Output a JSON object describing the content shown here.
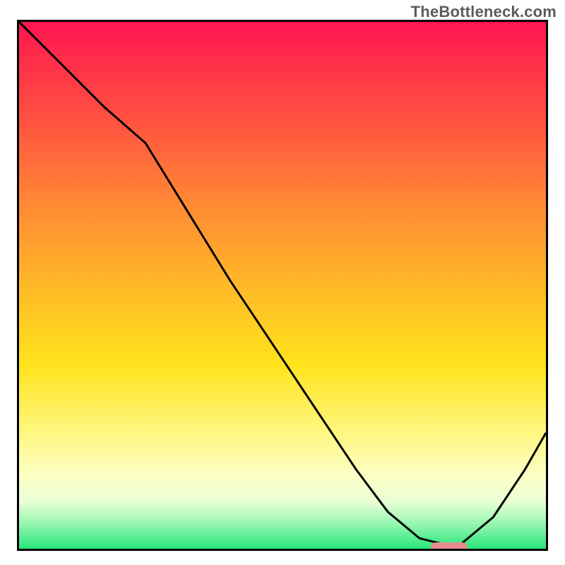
{
  "watermark": "TheBottleneck.com",
  "chart_data": {
    "type": "line",
    "title": "",
    "xlabel": "",
    "ylabel": "",
    "xlim": [
      0,
      100
    ],
    "ylim": [
      0,
      100
    ],
    "grid": false,
    "series": [
      {
        "name": "curve",
        "x": [
          0,
          8,
          16,
          24,
          32,
          40,
          48,
          56,
          64,
          70,
          76,
          80,
          84,
          90,
          96,
          100
        ],
        "values": [
          100,
          92,
          84,
          77,
          64,
          51,
          39,
          27,
          15,
          7,
          2,
          1,
          1,
          6,
          15,
          22
        ]
      }
    ],
    "annotations": [
      {
        "name": "valley-marker",
        "x_center": 81,
        "y": 1,
        "width_pct": 7
      }
    ],
    "background_gradient": {
      "direction": "vertical",
      "stops": [
        {
          "pos": 0.0,
          "color": "#ff1450"
        },
        {
          "pos": 0.5,
          "color": "#ffb928"
        },
        {
          "pos": 0.78,
          "color": "#fff780"
        },
        {
          "pos": 1.0,
          "color": "#28e67a"
        }
      ]
    }
  }
}
